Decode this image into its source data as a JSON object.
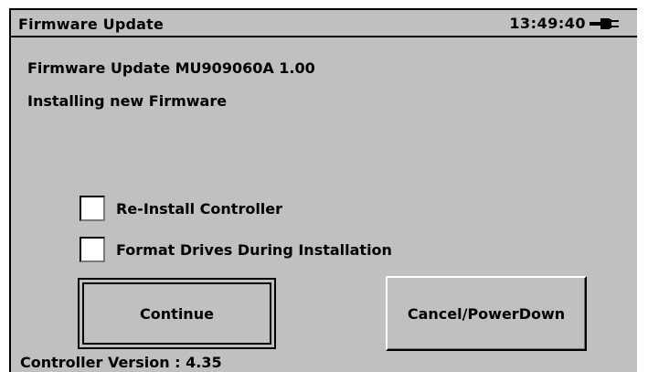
{
  "window": {
    "title": "Firmware Update",
    "clock": "13:49:40",
    "power_icon": "ac-power-plug-icon"
  },
  "content": {
    "update_line": "Firmware Update MU909060A 1.00",
    "status_line": "Installing new Firmware"
  },
  "options": [
    {
      "label": "Re-Install Controller",
      "checked": false
    },
    {
      "label": "Format Drives During Installation",
      "checked": false
    }
  ],
  "buttons": {
    "continue_label": "Continue",
    "cancel_label": "Cancel/PowerDown"
  },
  "footer": {
    "controller_version": "Controller Version : 4.35"
  },
  "colors": {
    "background": "#c0c0c0",
    "text": "#000000",
    "checkbox_fill": "#ffffff"
  }
}
